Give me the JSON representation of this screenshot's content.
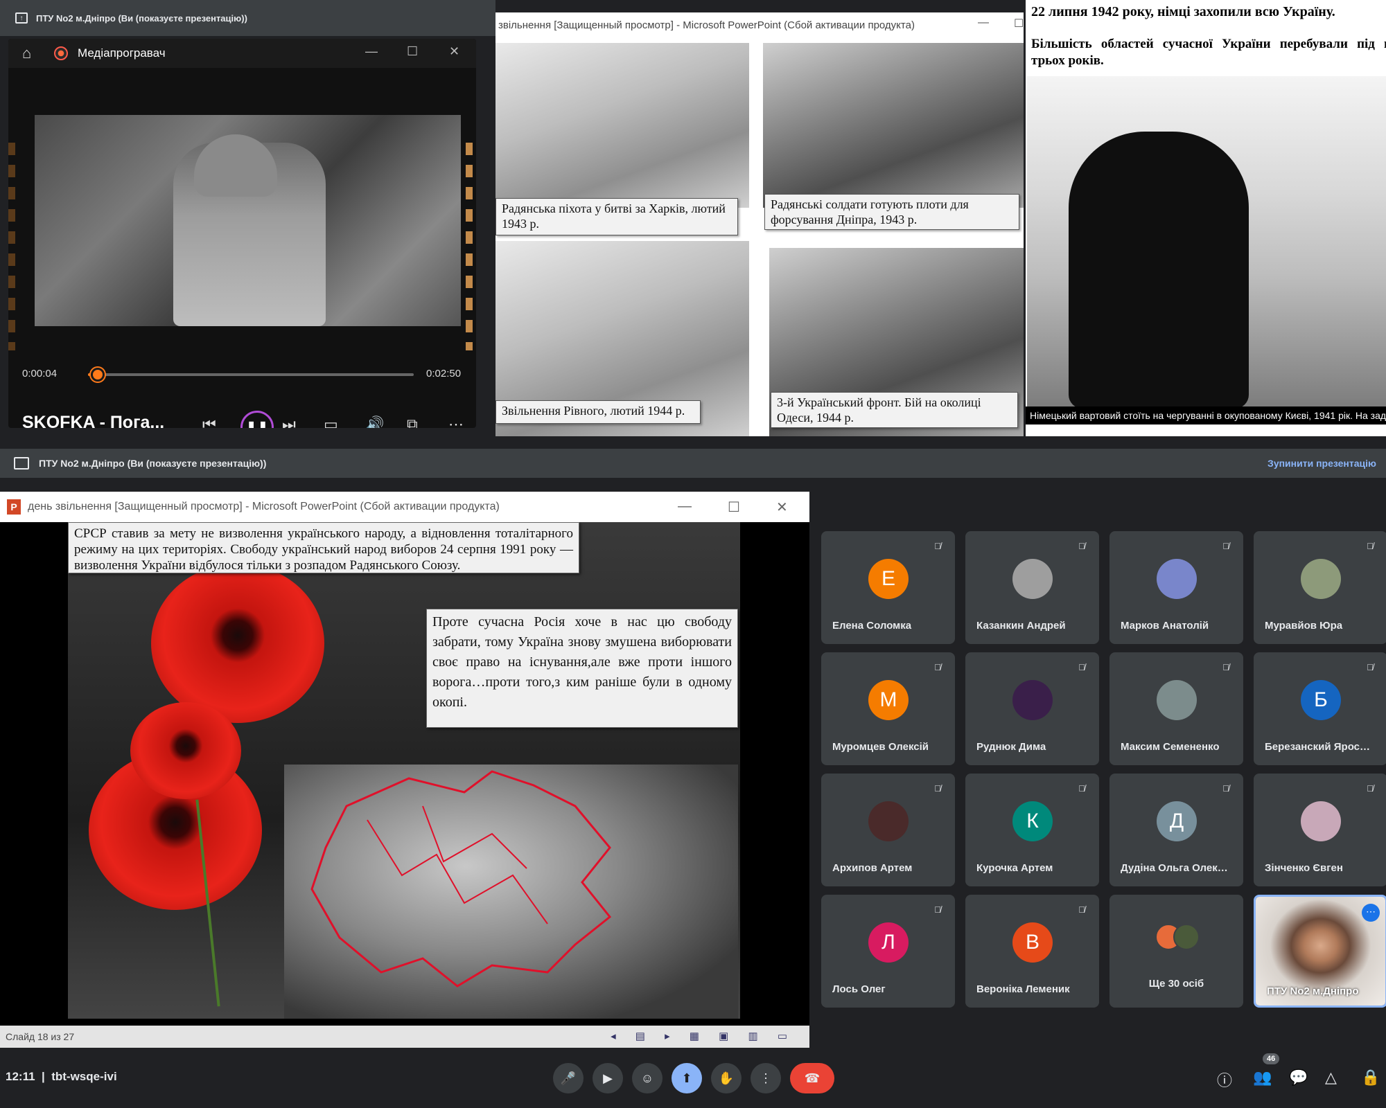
{
  "top_banner": {
    "text": "ПТУ No2 м.Дніпро (Ви (показуєте презентацію))"
  },
  "media_player": {
    "title": "Медіапрогравач",
    "current_time": "0:00:04",
    "total_time": "0:02:50",
    "progress_fraction": 0.03,
    "song_title": "SKOFKA - Пога...",
    "accent_color": "#ff7a1a",
    "controls": [
      "previous-icon",
      "pause-icon",
      "next-icon",
      "subtitles-icon",
      "volume-icon",
      "miniplayer-icon",
      "more-icon"
    ]
  },
  "ppt_top": {
    "title": "звільнення [Защищенный просмотр] - Microsoft PowerPoint (Сбой активации продукта)",
    "captions": [
      "Радянська піхота у битві за Харків, лютий 1943 р.",
      "Радянські солдати готують плоти для форсування Дніпра, 1943 р.",
      "Звільнення Рівного, лютий 1944 р.",
      "3-й Український фронт. Бій на околиці Одеси, 1944 р."
    ]
  },
  "kyiv_slide": {
    "heading": "22 липня 1942 року, німці захопили всю Україну.",
    "subheading": "Більшість областей сучасної України перебували під н трьох років.",
    "photo_caption": "Німецький вартовий стоїть на чергуванні в окупованому Києві, 1941 рік. На зад"
  },
  "banner2": {
    "text": "ПТУ No2 м.Дніпро (Ви (показуєте презентацію))",
    "stop_label": "Зупинити презентацію"
  },
  "ppt_main": {
    "icon_letter": "P",
    "title": "день звільнення [Защищенный просмотр] - Microsoft PowerPoint (Сбой активации продукта)",
    "text_top": "СРСР ставив за мету не визволення українського народу, а відновлення тоталітарного режиму на цих територіях. Свободу український народ виборов 24 серпня 1991 року — визволення України відбулося тільки з розпадом Радянського Союзу.",
    "text_right": "Проте сучасна Росія хоче в нас цю свободу забрати, тому Україна знову змушена виборювати своє право на існування,але вже проти іншого ворога…проти того,з ким раніше були в одному окопі.",
    "status": "Слайд 18 из 27"
  },
  "participants": [
    {
      "name": "Елена Соломка",
      "initial": "Е",
      "color": "#f57c00"
    },
    {
      "name": "Казанкин Андрей",
      "initial": "",
      "color": "#9e9e9e"
    },
    {
      "name": "Марков Анатолій",
      "initial": "",
      "color": "#7986cb"
    },
    {
      "name": "Муравйов Юра",
      "initial": "",
      "color": "#8d9a7a"
    },
    {
      "name": "Муромцев Олексій",
      "initial": "М",
      "color": "#f57c00"
    },
    {
      "name": "Руднюк Дима",
      "initial": "",
      "color": "#3a1f4a"
    },
    {
      "name": "Максим Семененко",
      "initial": "",
      "color": "#7c8c8c"
    },
    {
      "name": "Березанский Ярос…",
      "initial": "Б",
      "color": "#1565c0"
    },
    {
      "name": "Архипов Артем",
      "initial": "",
      "color": "#4a2a2a"
    },
    {
      "name": "Курочка Артем",
      "initial": "К",
      "color": "#00897b"
    },
    {
      "name": "Дудіна Ольга Олек…",
      "initial": "Д",
      "color": "#78909c"
    },
    {
      "name": "Зінченко Євген",
      "initial": "",
      "color": "#c8a8b8"
    },
    {
      "name": "Лось Олег",
      "initial": "Л",
      "color": "#d81b60"
    },
    {
      "name": "Вероніка Леменик",
      "initial": "В",
      "color": "#e64a19"
    }
  ],
  "more_participants": "Ще 30 осіб",
  "self_tile": {
    "name": "ПТУ No2 м.Дніпро"
  },
  "bottom_bar": {
    "time": "12:11",
    "separator": "|",
    "meeting_code": "tbt-wsqe-ivi",
    "people_count": "46",
    "hangup_color": "#ea4335",
    "present_color": "#8ab4f8"
  }
}
